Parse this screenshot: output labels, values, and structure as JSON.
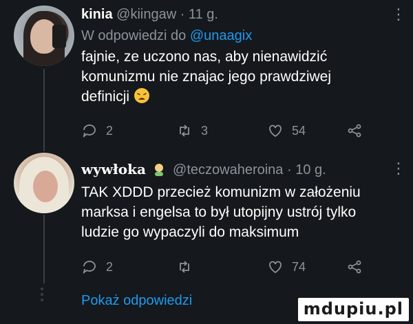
{
  "tweets": [
    {
      "username": "kinia",
      "handle": "@kiingaw",
      "time": "· 11 g.",
      "reply_to_prefix": "W odpowiedzi do",
      "reply_to_handle": "@unaagix",
      "text": "fajnie, ze uczono nas, aby nienawidzić komunizmu nie znajac jego prawdziwej definicji",
      "emoji": "tired-face-emoji",
      "stats": {
        "replies": "2",
        "retweets": "3",
        "likes": "54"
      }
    },
    {
      "username": "wywłoka",
      "badge": "woman-emoji",
      "handle": "@teczowaheroina",
      "time": "· 10 g.",
      "text": "TAK XDDD przecież komunizm w założeniu marksa i engelsa to był utopijny ustrój tylko ludzie go wypaczyli do maksimum",
      "stats": {
        "replies": "2",
        "retweets": "",
        "likes": "74"
      }
    }
  ],
  "show_replies": "Pokaż odpowiedzi",
  "watermark": "mdupiu.pl",
  "colors": {
    "background": "#15181c",
    "muted": "#8b949c",
    "accent": "#1d9bf0",
    "text": "#ffffff"
  }
}
